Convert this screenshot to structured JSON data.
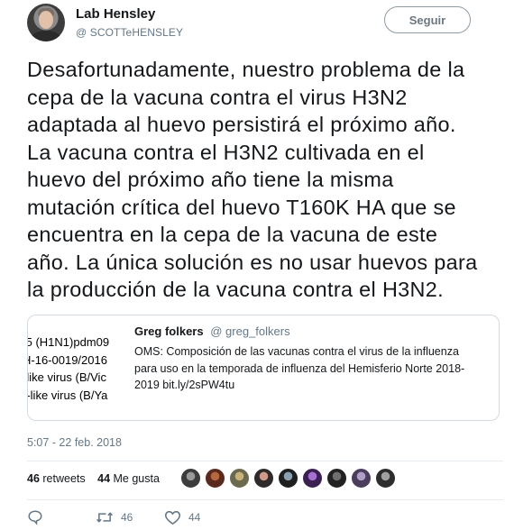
{
  "tweet": {
    "author_name": "Lab Hensley",
    "author_handle": "@ SCOTTeHENSLEY",
    "follow_label": "Seguir",
    "text_lines": [
      "Desafortunadamente, nuestro problema de la",
      "cepa de la vacuna contra el virus H3N2",
      "adaptada al huevo persistirá el próximo año.",
      "La vacuna contra el H3N2 cultivada en el",
      "huevo del próximo año tiene la misma",
      "mutación crítica del huevo T160K HA que se",
      "encuentra en la cepa de la vacuna de este",
      "año. La única solución es no usar huevos para",
      "la producción de la vacuna contra el H3N2."
    ],
    "timestamp": "5:07 - 22 feb. 2018"
  },
  "quoted": {
    "author_name": "Greg folkers",
    "author_handle": "@ greg_folkers",
    "text_lines": [
      "OMS: Composición de las vacunas contra el virus de la influenza",
      "para uso en la temporada de influenza del Hemisferio Norte 2018-",
      "2019  bit.ly/2sPW4tu"
    ],
    "thumbnail_lines": [
      ".5 (H1N1)pdm09",
      "H-16-0019/2016",
      "-like virus (B/Vic",
      "}-like virus (B/Ya"
    ]
  },
  "stats": {
    "retweets_count": "46",
    "retweets_label": "retweets",
    "likes_count": "44",
    "likes_label": "Me gusta"
  },
  "likers": [
    {
      "color": "#3c3c3c",
      "accent": "#9a9a9a"
    },
    {
      "color": "#5a2a1e",
      "accent": "#b5673f"
    },
    {
      "color": "#6b6a4e",
      "accent": "#c9b27a"
    },
    {
      "color": "#2f2a2a",
      "accent": "#d09a8a"
    },
    {
      "color": "#1f1f1f",
      "accent": "#8aa0b0"
    },
    {
      "color": "#3a2152",
      "accent": "#a66fd0"
    },
    {
      "color": "#222222",
      "accent": "#6f6f6f"
    },
    {
      "color": "#4b3e5c",
      "accent": "#b0a0c8"
    },
    {
      "color": "#2d2d2d",
      "accent": "#a0a0a0"
    }
  ],
  "actions": {
    "reply_icon": "reply-icon",
    "retweet_icon": "retweet-icon",
    "retweet_count": "46",
    "like_icon": "heart-icon",
    "like_count": "44"
  },
  "colors": {
    "text": "#14171a",
    "secondary": "#657786",
    "border": "#e6ecf0"
  }
}
